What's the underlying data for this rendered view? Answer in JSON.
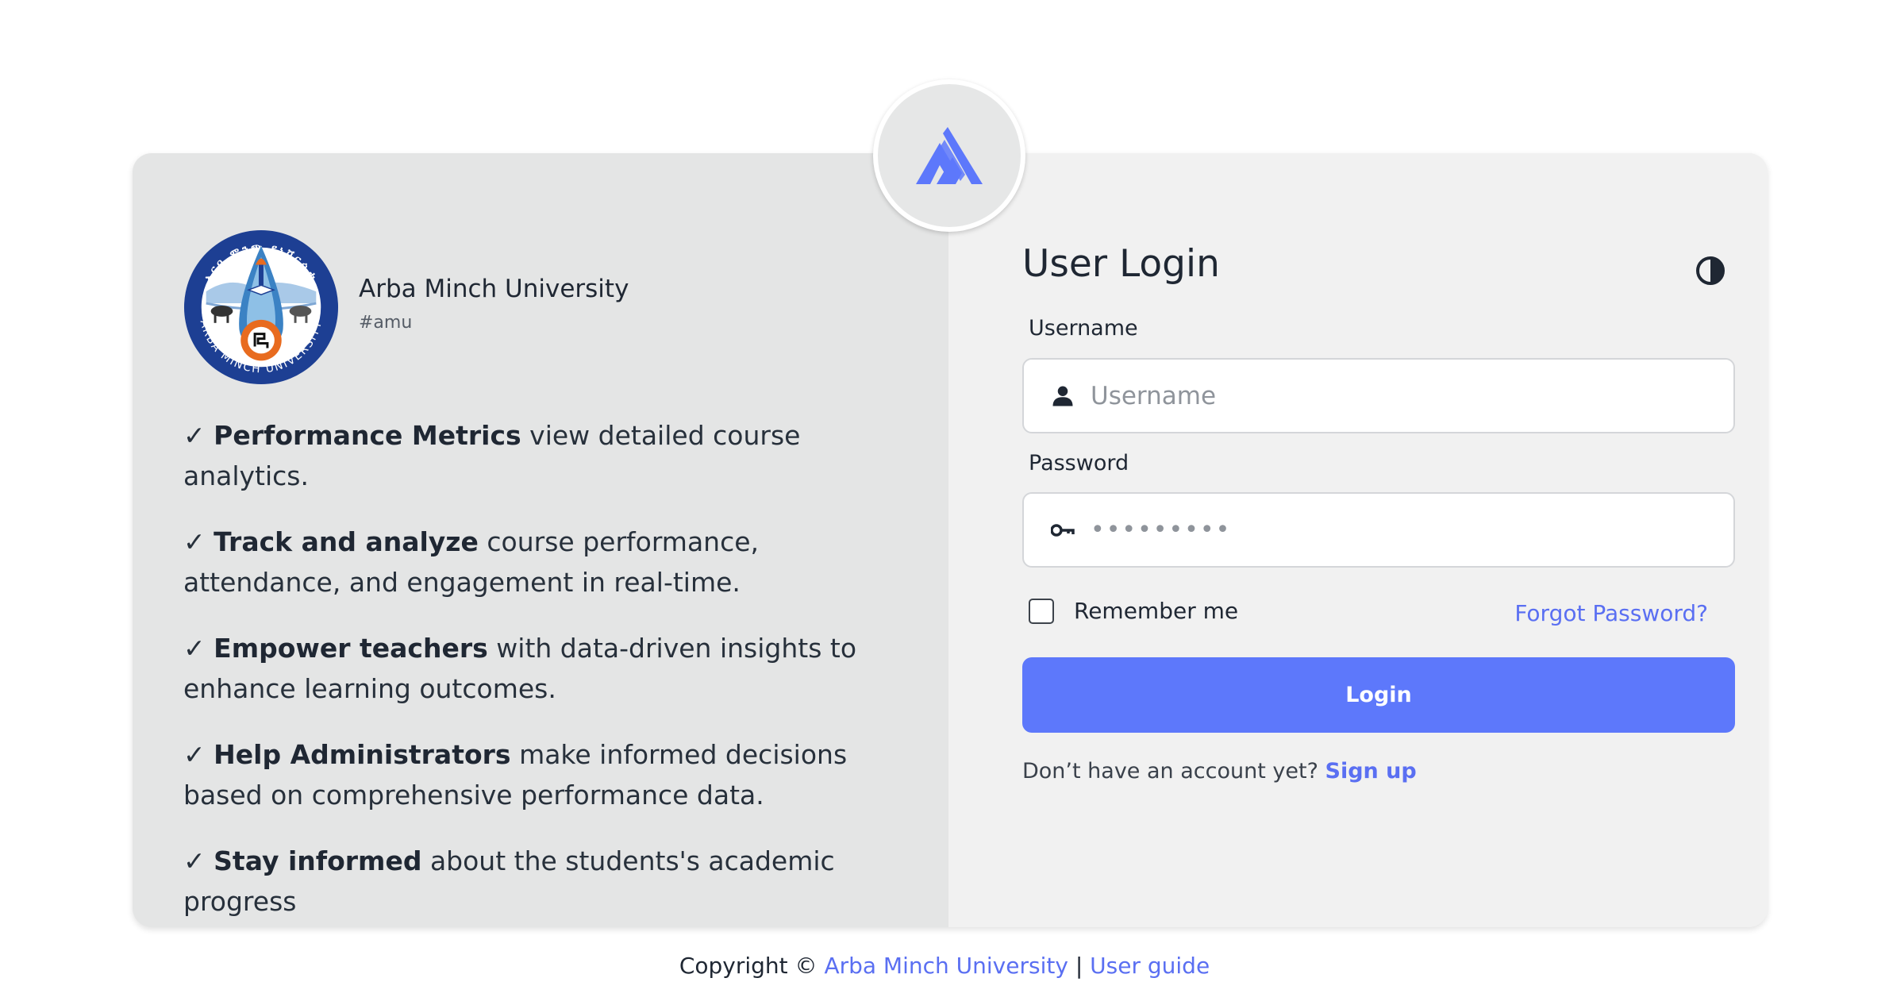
{
  "university": {
    "name": "Arba Minch University",
    "tag": "#amu",
    "seal_text_top": "አርባ ምንጭ ዩኒቨርሲቲ",
    "seal_text_bottom": "ARBA MINCH UNIVERSITY"
  },
  "features": [
    {
      "check": "✓",
      "strong": "Performance Metrics",
      "rest": " view detailed course analytics."
    },
    {
      "check": "✓",
      "strong": "Track and analyze",
      "rest": " course performance, attendance, and engagement in real-time."
    },
    {
      "check": "✓",
      "strong": "Empower teachers",
      "rest": " with data-driven insights to enhance learning outcomes."
    },
    {
      "check": "✓",
      "strong": "Help Administrators",
      "rest": " make informed decisions based on comprehensive performance data."
    },
    {
      "check": "✓",
      "strong": "Stay informed",
      "rest": " about the students's academic progress"
    }
  ],
  "login": {
    "title": "User Login",
    "username_label": "Username",
    "username_placeholder": "Username",
    "password_label": "Password",
    "password_value": "•••••••••",
    "remember_label": "Remember me",
    "forgot_label": "Forgot Password?",
    "button_label": "Login",
    "signup_prompt": "Don’t have an account yet?",
    "signup_link": "Sign up"
  },
  "footer": {
    "copyright": "Copyright ©",
    "university_link": "Arba Minch University",
    "separator": "|",
    "guide_link": "User guide"
  },
  "icons": {
    "app_logo": "mountain-logo-icon",
    "theme": "half-circle-contrast-icon",
    "user": "user-icon",
    "key": "key-icon"
  },
  "colors": {
    "accent": "#5d78fb",
    "link": "#5a6ff2",
    "left_panel_bg": "#e4e5e5",
    "right_panel_bg": "#f1f1f1",
    "seal_blue": "#1d3f93",
    "seal_orange": "#e86b1f"
  }
}
